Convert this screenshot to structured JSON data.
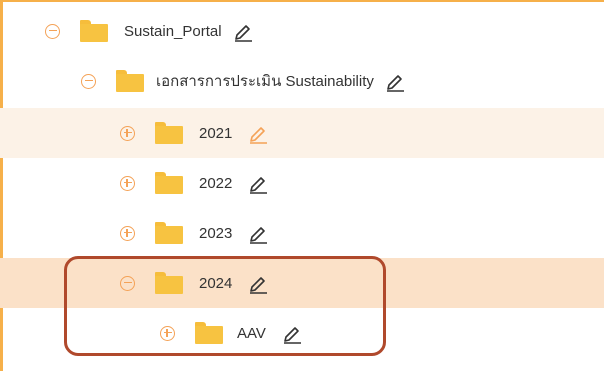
{
  "colors": {
    "toggle": "#f4a257",
    "folder": "#f7c341",
    "highlight_light": "#fcf2e7",
    "highlight_strong": "#fbe1c8",
    "edit_icon_default": "#333333",
    "edit_icon_active": "#f4a257",
    "annotation_box": "#b0492c",
    "frame_border": "#f6b04a"
  },
  "tree": {
    "root": {
      "label": "Sustain_Portal",
      "toggle": "collapse-icon",
      "edit_icon": "pencil-edit-icon"
    },
    "docs": {
      "label": "เอกสารการประเมิน Sustainability",
      "toggle": "collapse-icon",
      "edit_icon": "pencil-edit-icon"
    },
    "y2021": {
      "label": "2021",
      "toggle": "expand-icon",
      "edit_icon": "pencil-edit-icon"
    },
    "y2022": {
      "label": "2022",
      "toggle": "expand-icon",
      "edit_icon": "pencil-edit-icon"
    },
    "y2023": {
      "label": "2023",
      "toggle": "expand-icon",
      "edit_icon": "pencil-edit-icon"
    },
    "y2024": {
      "label": "2024",
      "toggle": "collapse-icon",
      "edit_icon": "pencil-edit-icon"
    },
    "aav": {
      "label": "AAV",
      "toggle": "expand-icon",
      "edit_icon": "pencil-edit-icon"
    }
  }
}
